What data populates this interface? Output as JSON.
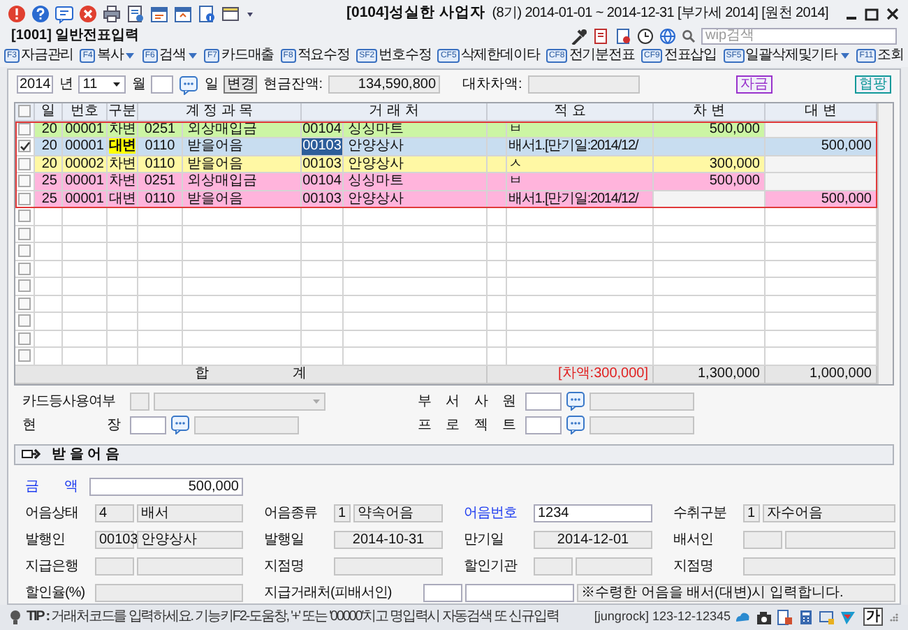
{
  "window": {
    "title": "[0104]성실한 사업자",
    "info": "(8기) 2014-01-01 ~ 2014-12-31 [부가세 2014] [원천 2014]"
  },
  "screen_title": "[1001] 일반전표입력",
  "search": {
    "placeholder": "wip검색"
  },
  "toolbar": [
    {
      "key": "F3",
      "label": "자금관리",
      "dropdown": false
    },
    {
      "key": "F4",
      "label": "복사",
      "dropdown": true
    },
    {
      "key": "F6",
      "label": "검색",
      "dropdown": true
    },
    {
      "key": "F7",
      "label": "카드매출",
      "dropdown": false
    },
    {
      "key": "F8",
      "label": "적요수정",
      "dropdown": false
    },
    {
      "key": "SF2",
      "label": "번호수정",
      "dropdown": false
    },
    {
      "key": "CF5",
      "label": "삭제한데이타",
      "dropdown": false
    },
    {
      "key": "CF8",
      "label": "전기분전표",
      "dropdown": false
    },
    {
      "key": "CF9",
      "label": "전표삽입",
      "dropdown": false
    },
    {
      "key": "SF5",
      "label": "일괄삭제및기타",
      "dropdown": true
    },
    {
      "key": "F11",
      "label": "조회",
      "dropdown": false
    }
  ],
  "filter": {
    "year": "2014",
    "year_unit": "년",
    "month": "11",
    "month_unit": "월",
    "day_unit": "일",
    "change_button": "변경",
    "cash_label": "현금잔액:",
    "cash": "134,590,800",
    "diff_label": "대차차액:",
    "badges": [
      {
        "label": "자금",
        "color": "#9933cc"
      },
      {
        "label": "협팡",
        "color": "#119999"
      }
    ]
  },
  "journal": {
    "columns": [
      "일",
      "번호",
      "구분",
      "계 정 과 목",
      "거 래 처",
      "적 요",
      "차 변",
      "대 변"
    ],
    "rows": [
      {
        "checked": false,
        "selected": false,
        "color": "#ccf5a4",
        "day": "20",
        "no": "00001",
        "type": "차변",
        "acct_code": "0251",
        "acct_name": "외상매입금",
        "client_code": "00104",
        "client_name": "싱싱마트",
        "memo": "ㅂ",
        "debit": "500,000"
      },
      {
        "checked": true,
        "selected": true,
        "color": "#c8ddf0",
        "day": "20",
        "no": "00001",
        "type": "대변",
        "acct_code": "0110",
        "acct_name": "받을어음",
        "client_code": "00103",
        "client_name": "안양상사",
        "memo": "배서1.[만기일:2014/12/",
        "credit": "500,000"
      },
      {
        "checked": false,
        "selected": false,
        "color": "#fff8a4",
        "day": "20",
        "no": "00002",
        "type": "차변",
        "acct_code": "0110",
        "acct_name": "받을어음",
        "client_code": "00103",
        "client_name": "안양상사",
        "memo": "ㅅ",
        "debit": "300,000"
      },
      {
        "checked": false,
        "selected": false,
        "color": "#ffb4dc",
        "day": "25",
        "no": "00001",
        "type": "차변",
        "acct_code": "0251",
        "acct_name": "외상매입금",
        "client_code": "00104",
        "client_name": "싱싱마트",
        "memo": "ㅂ",
        "debit": "500,000"
      },
      {
        "checked": false,
        "selected": false,
        "color": "#ffb4dc",
        "day": "25",
        "no": "00001",
        "type": "대변",
        "acct_code": "0110",
        "acct_name": "받을어음",
        "client_code": "00103",
        "client_name": "안양상사",
        "memo": "배서1.[만기일:2014/12/",
        "credit": "500,000"
      }
    ],
    "select_all": {
      "checked": false
    },
    "empty_rows": [
      {
        "checked": false
      },
      {
        "checked": false
      },
      {
        "checked": false
      },
      {
        "checked": false
      },
      {
        "checked": false
      },
      {
        "checked": false
      },
      {
        "checked": false
      },
      {
        "checked": false
      },
      {
        "checked": false
      }
    ],
    "total": {
      "label": "합 계",
      "difference": "[차액:300,000]",
      "debit": "1,300,000",
      "credit": "1,000,000"
    }
  },
  "extra_fields": [
    {
      "label": "카드등사용여부",
      "kind": "dropdown"
    },
    {
      "label": "부 서 사 원",
      "kind": "lookup"
    },
    {
      "label": "현 장",
      "kind": "lookup"
    },
    {
      "label": "프 로 젝 트",
      "kind": "lookup"
    }
  ],
  "section": {
    "title": "받 을 어 음"
  },
  "bill": {
    "amount": {
      "label": "금 액",
      "value": "500,000"
    },
    "rows": [
      [
        {
          "label": "어음상태",
          "accent": false,
          "wide": false,
          "fields": [
            {
              "kind": "code",
              "text": "4",
              "editable": false
            },
            {
              "kind": "text",
              "text": "배서",
              "editable": false
            }
          ]
        },
        {
          "label": "어음종류",
          "accent": false,
          "wide": false,
          "fields": [
            {
              "kind": "digit",
              "text": "1",
              "editable": false
            },
            {
              "kind": "text",
              "text": "약속어음",
              "editable": false
            }
          ]
        },
        {
          "label": "어음번호",
          "accent": true,
          "wide": false,
          "fields": [
            {
              "kind": "text",
              "text": "1234",
              "editable": true
            }
          ]
        },
        {
          "label": "수취구분",
          "accent": false,
          "wide": false,
          "fields": [
            {
              "kind": "digit",
              "text": "1",
              "editable": false
            },
            {
              "kind": "text",
              "text": "자수어음",
              "editable": false
            }
          ]
        }
      ],
      [
        {
          "label": "발행인",
          "accent": false,
          "wide": false,
          "fields": [
            {
              "kind": "code",
              "text": "00103",
              "editable": false
            },
            {
              "kind": "text",
              "text": "안양상사",
              "editable": false
            }
          ]
        },
        {
          "label": "발행일",
          "accent": false,
          "wide": false,
          "fields": [
            {
              "kind": "date",
              "text": "2014-10-31",
              "editable": false
            }
          ]
        },
        {
          "label": "만기일",
          "accent": false,
          "wide": false,
          "fields": [
            {
              "kind": "date",
              "text": "2014-12-01",
              "editable": false
            }
          ]
        },
        {
          "label": "배서인",
          "accent": false,
          "wide": false,
          "fields": [
            {
              "kind": "code",
              "editable": false
            },
            {
              "kind": "text",
              "editable": false
            }
          ]
        }
      ],
      [
        {
          "label": "지급은행",
          "accent": false,
          "wide": false,
          "fields": [
            {
              "kind": "code",
              "editable": false
            },
            {
              "kind": "text",
              "editable": false
            }
          ]
        },
        {
          "label": "지점명",
          "accent": false,
          "wide": false,
          "fields": [
            {
              "kind": "text",
              "editable": false
            }
          ]
        },
        {
          "label": "할인기관",
          "accent": false,
          "wide": false,
          "fields": [
            {
              "kind": "code",
              "editable": false
            },
            {
              "kind": "text",
              "editable": false
            }
          ]
        },
        {
          "label": "지점명",
          "accent": false,
          "wide": false,
          "fields": [
            {
              "kind": "text",
              "editable": false
            }
          ]
        }
      ],
      [
        {
          "label": "할인율(%)",
          "accent": false,
          "wide": false,
          "fields": [
            {
              "kind": "text",
              "editable": false
            }
          ]
        },
        {
          "label": "지급거래처(피배서인)",
          "accent": false,
          "wide": true,
          "fields": [
            {
              "kind": "code",
              "editable": true
            },
            {
              "kind": "name",
              "editable": true
            },
            {
              "kind": "text",
              "text": "※수령한 어음을 배서(대변)시 입력합니다.",
              "editable": false
            }
          ]
        }
      ]
    ]
  },
  "status_bar": {
    "tip": "**TIP :** 거래처코드를 입력하세요. 기능키F2-도움창, '+' 또는 '00000'치고 명입력시 자동검색 또 신규입력",
    "user": "[jungrock] 123-12-12345",
    "ime": "가"
  }
}
